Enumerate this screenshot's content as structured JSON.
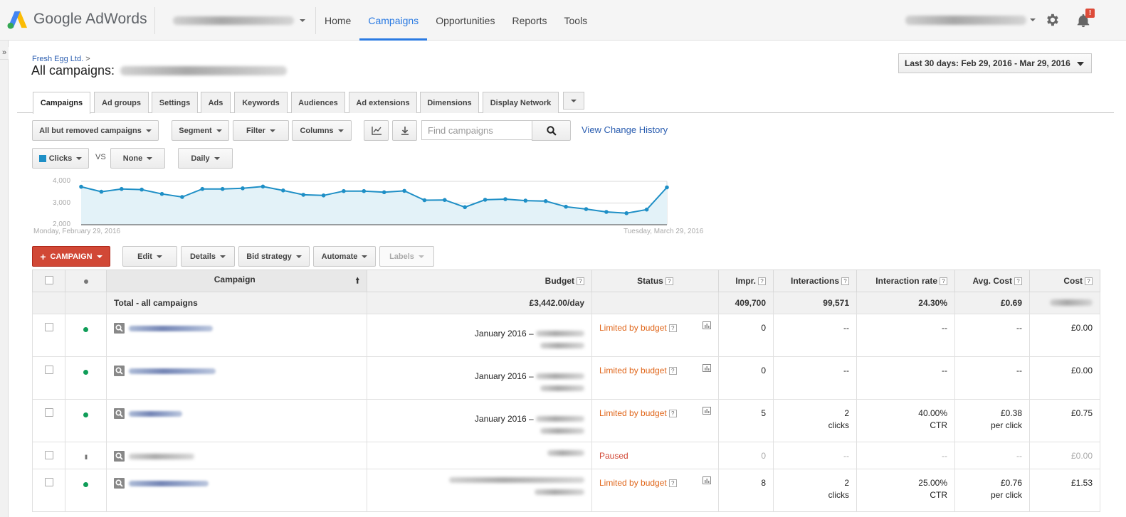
{
  "app": {
    "name": "Google AdWords"
  },
  "nav": [
    {
      "label": "Home",
      "active": false
    },
    {
      "label": "Campaigns",
      "active": true
    },
    {
      "label": "Opportunities",
      "active": false
    },
    {
      "label": "Reports",
      "active": false
    },
    {
      "label": "Tools",
      "active": false
    }
  ],
  "notification_badge": "!",
  "rail_toggle": "»",
  "breadcrumb": {
    "account": "Fresh Egg Ltd.",
    "separator": ">"
  },
  "page_title": "All campaigns:",
  "date_range": "Last 30 days: Feb 29, 2016 - Mar 29, 2016",
  "tabs": [
    "Campaigns",
    "Ad groups",
    "Settings",
    "Ads",
    "Keywords",
    "Audiences",
    "Ad extensions",
    "Dimensions",
    "Display Network"
  ],
  "toolbar": {
    "view_filter": "All but removed campaigns",
    "segment": "Segment",
    "filter": "Filter",
    "columns": "Columns",
    "search_placeholder": "Find campaigns",
    "view_change_history": "View Change History"
  },
  "chart_controls": {
    "metric1": "Clicks",
    "vs": "VS",
    "metric2": "None",
    "interval": "Daily"
  },
  "chart_data": {
    "type": "line",
    "series": [
      {
        "name": "Clicks",
        "values": [
          3750,
          3520,
          3650,
          3620,
          3420,
          3280,
          3650,
          3650,
          3680,
          3760,
          3580,
          3380,
          3350,
          3550,
          3550,
          3500,
          3560,
          3130,
          3140,
          2810,
          3150,
          3180,
          3110,
          3090,
          2830,
          2720,
          2590,
          2530,
          2700,
          3720
        ]
      }
    ],
    "y_ticks": [
      "4,000",
      "3,000",
      "2,000"
    ],
    "ylim": [
      2000,
      4000
    ],
    "x_start_label": "Monday, February 29, 2016",
    "x_end_label": "Tuesday, March 29, 2016",
    "line_color": "#1e8fc6",
    "fill_color": "#e3f2f8"
  },
  "actions": {
    "new_campaign": "CAMPAIGN",
    "edit": "Edit",
    "details": "Details",
    "bid_strategy": "Bid strategy",
    "automate": "Automate",
    "labels": "Labels"
  },
  "table": {
    "headers": {
      "campaign": "Campaign",
      "budget": "Budget",
      "status": "Status",
      "impr": "Impr.",
      "interactions": "Interactions",
      "interaction_rate": "Interaction rate",
      "avg_cost": "Avg. Cost",
      "cost": "Cost"
    },
    "total": {
      "label": "Total - all campaigns",
      "budget": "£3,442.00/day",
      "impr": "409,700",
      "interactions": "99,571",
      "interaction_rate": "24.30%",
      "avg_cost": "£0.69"
    },
    "rows": [
      {
        "budget_date": "January 2016 –",
        "status": "Limited by budget",
        "impr": "0",
        "interactions": "--",
        "interactions_sub": "",
        "rate": "--",
        "rate_sub": "",
        "avg_cost": "--",
        "avg_cost_sub": "",
        "cost": "£0.00"
      },
      {
        "budget_date": "January 2016 –",
        "status": "Limited by budget",
        "impr": "0",
        "interactions": "--",
        "interactions_sub": "",
        "rate": "--",
        "rate_sub": "",
        "avg_cost": "--",
        "avg_cost_sub": "",
        "cost": "£0.00"
      },
      {
        "budget_date": "January 2016 –",
        "status": "Limited by budget",
        "impr": "5",
        "interactions": "2",
        "interactions_sub": "clicks",
        "rate": "40.00%",
        "rate_sub": "CTR",
        "avg_cost": "£0.38",
        "avg_cost_sub": "per click",
        "cost": "£0.75"
      },
      {
        "budget_date": "",
        "status": "Paused",
        "impr": "0",
        "interactions": "--",
        "interactions_sub": "",
        "rate": "--",
        "rate_sub": "",
        "avg_cost": "--",
        "avg_cost_sub": "",
        "cost": "£0.00"
      },
      {
        "budget_date": "",
        "status": "Limited by budget",
        "impr": "8",
        "interactions": "2",
        "interactions_sub": "clicks",
        "rate": "25.00%",
        "rate_sub": "CTR",
        "avg_cost": "£0.76",
        "avg_cost_sub": "per click",
        "cost": "£1.53"
      }
    ]
  },
  "help_glyph": "?",
  "colors": {
    "accent": "#2a7ae2",
    "link": "#2a5db0",
    "new_button": "#d14836",
    "limited": "#e0661a",
    "enabled_dot": "#0f9d58"
  }
}
